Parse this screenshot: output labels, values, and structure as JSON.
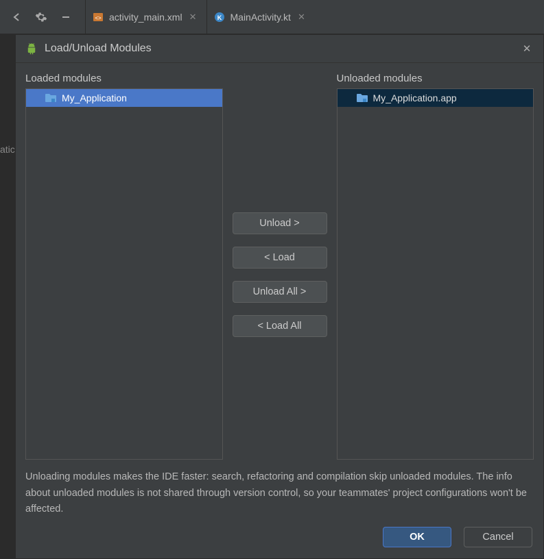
{
  "toolbar": {
    "tab1_label": "activity_main.xml",
    "tab2_label": "MainActivity.kt"
  },
  "sidebar": {
    "fragment": "atic"
  },
  "dialog": {
    "title": "Load/Unload Modules",
    "loaded_label": "Loaded modules",
    "unloaded_label": "Unloaded modules",
    "loaded_items": [
      "My_Application"
    ],
    "unloaded_items": [
      "My_Application.app"
    ],
    "btn_unload": "Unload >",
    "btn_load": "< Load",
    "btn_unload_all": "Unload All >",
    "btn_load_all": "< Load All",
    "info": "Unloading modules makes the IDE faster: search, refactoring and compilation skip unloaded modules. The info about unloaded modules is not shared through version control, so your teammates' project configurations won't be affected.",
    "ok_label": "OK",
    "cancel_label": "Cancel"
  }
}
